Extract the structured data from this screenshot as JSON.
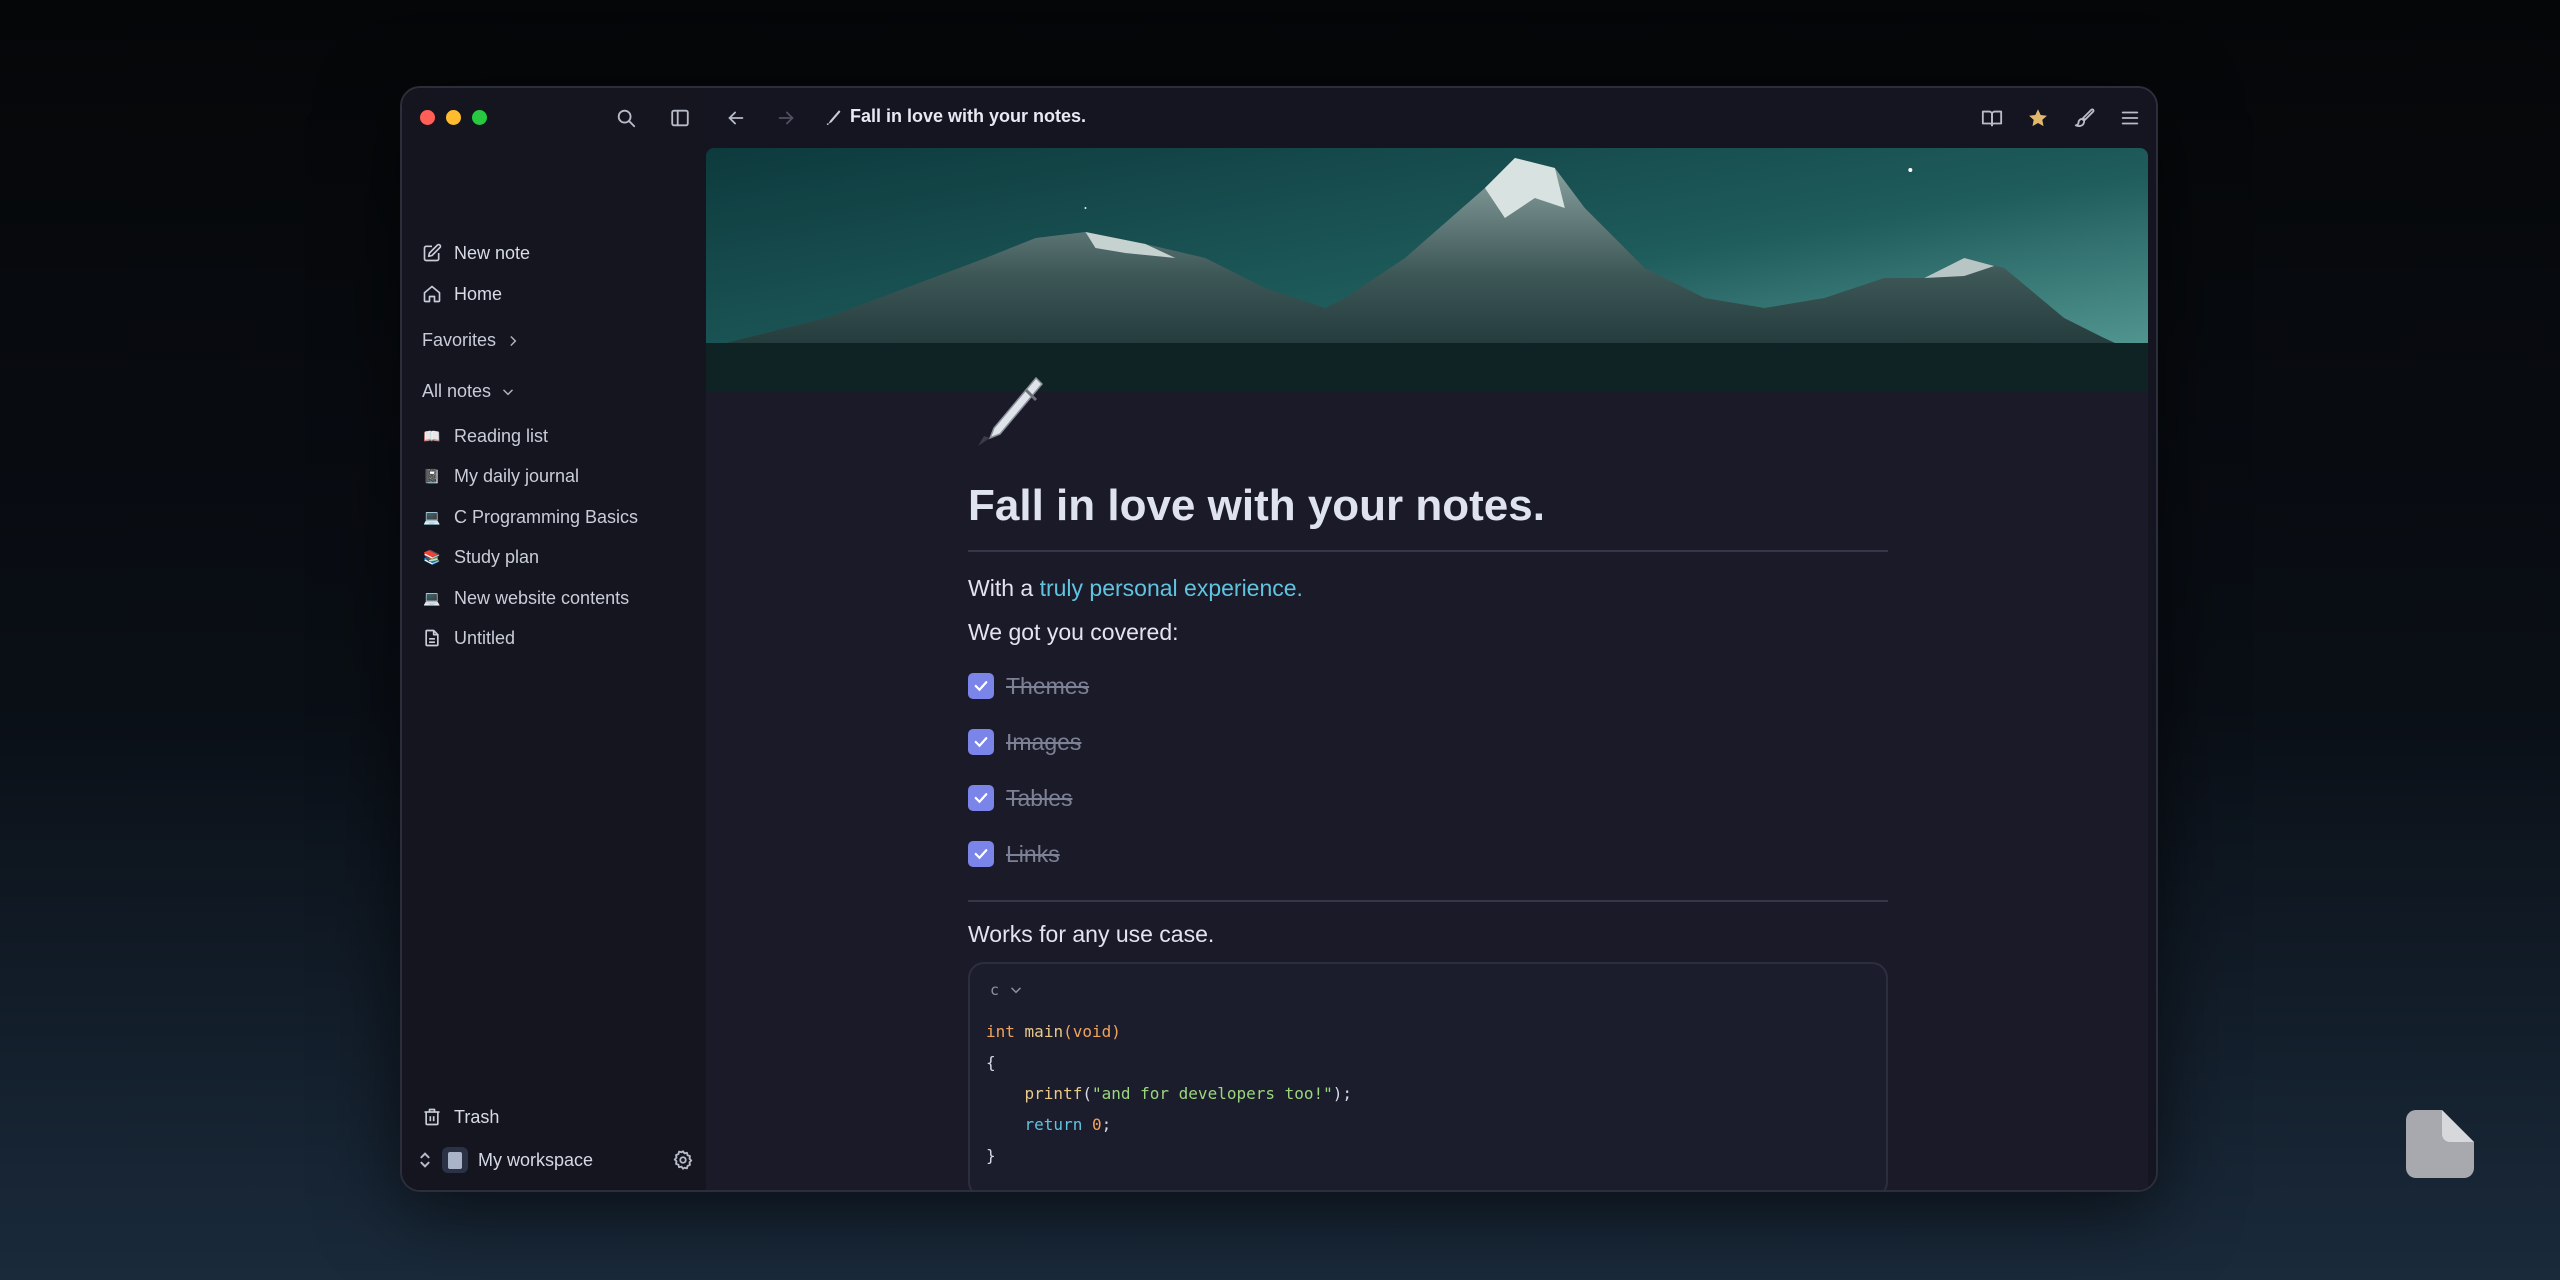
{
  "window": {
    "breadcrumb_title": "Fall in love with your notes."
  },
  "sidebar": {
    "new_note": "New note",
    "home": "Home",
    "favorites": "Favorites",
    "all_notes": "All notes",
    "notes": [
      {
        "emoji": "📖",
        "label": "Reading list"
      },
      {
        "emoji": "📓",
        "label": "My daily journal"
      },
      {
        "emoji": "💻",
        "label": "C Programming Basics"
      },
      {
        "emoji": "📚",
        "label": "Study plan"
      },
      {
        "emoji": "💻",
        "label": "New website contents"
      },
      {
        "emoji": "",
        "label": "Untitled"
      }
    ],
    "trash": "Trash",
    "workspace": "My workspace"
  },
  "document": {
    "title": "Fall in love with your notes.",
    "intro_prefix": "With a ",
    "intro_link": "truly personal experience.",
    "covered": "We got you covered:",
    "todos": [
      "Themes",
      "Images",
      "Tables",
      "Links"
    ],
    "use_case": "Works for any use case.",
    "code_lang": "c",
    "code": {
      "l1_kw": "int",
      "l1_fn": "main",
      "l1_rest": "(void)",
      "l2": "{",
      "l3_fn": "printf",
      "l3_open": "(",
      "l3_str": "\"and for developers too!\"",
      "l3_close": ");",
      "l4_kw": "return",
      "l4_num": "0",
      "l4_end": ";",
      "l5": "}"
    }
  },
  "icons": {
    "search": "search-icon",
    "sidebar_toggle": "sidebar-toggle-icon",
    "back": "arrow-left-icon",
    "forward": "arrow-right-icon",
    "reader": "book-open-icon",
    "favorite": "star-icon",
    "theme": "paintbrush-icon",
    "menu": "hamburger-menu-icon"
  },
  "colors": {
    "accent": "#7b84e8",
    "link": "#5fc4e0",
    "favorite_star": "#e2b86d",
    "background": "#1a1a29"
  }
}
